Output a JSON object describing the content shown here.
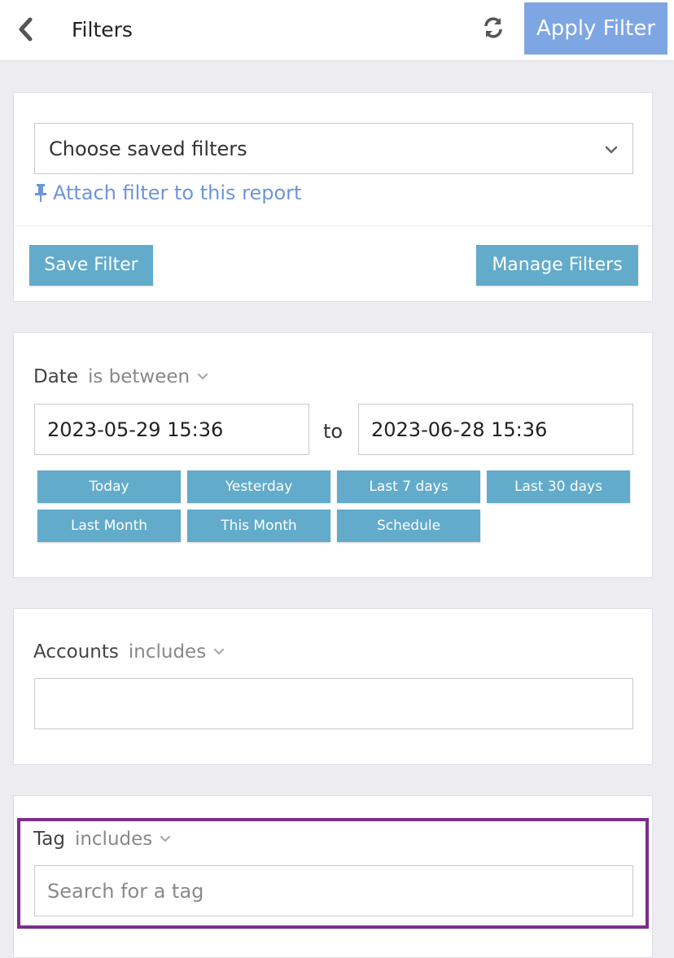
{
  "header": {
    "back_icon": "chevron-left-icon",
    "title": "Filters",
    "refresh_icon": "refresh-icon",
    "apply_label": "Apply Filter"
  },
  "saved_filters": {
    "select_value": "Choose saved filters",
    "attach_icon": "pin-icon",
    "attach_label": "Attach filter to this report",
    "save_label": "Save Filter",
    "manage_label": "Manage Filters"
  },
  "date_filter": {
    "field": "Date",
    "operator": "is between",
    "from_value": "2023-05-29 15:36",
    "to_label": "to",
    "to_value": "2023-06-28 15:36",
    "presets": [
      "Today",
      "Yesterday",
      "Last 7 days",
      "Last 30 days",
      "Last Month",
      "This Month",
      "Schedule"
    ]
  },
  "accounts_filter": {
    "field": "Accounts",
    "operator": "includes",
    "value": ""
  },
  "tag_filter": {
    "field": "Tag",
    "operator": "includes",
    "placeholder": "Search for a tag"
  },
  "colors": {
    "apply_button": "#7da6e3",
    "action_button": "#62abcb",
    "link": "#6d95d8",
    "highlight_border": "#7b2d8b"
  }
}
